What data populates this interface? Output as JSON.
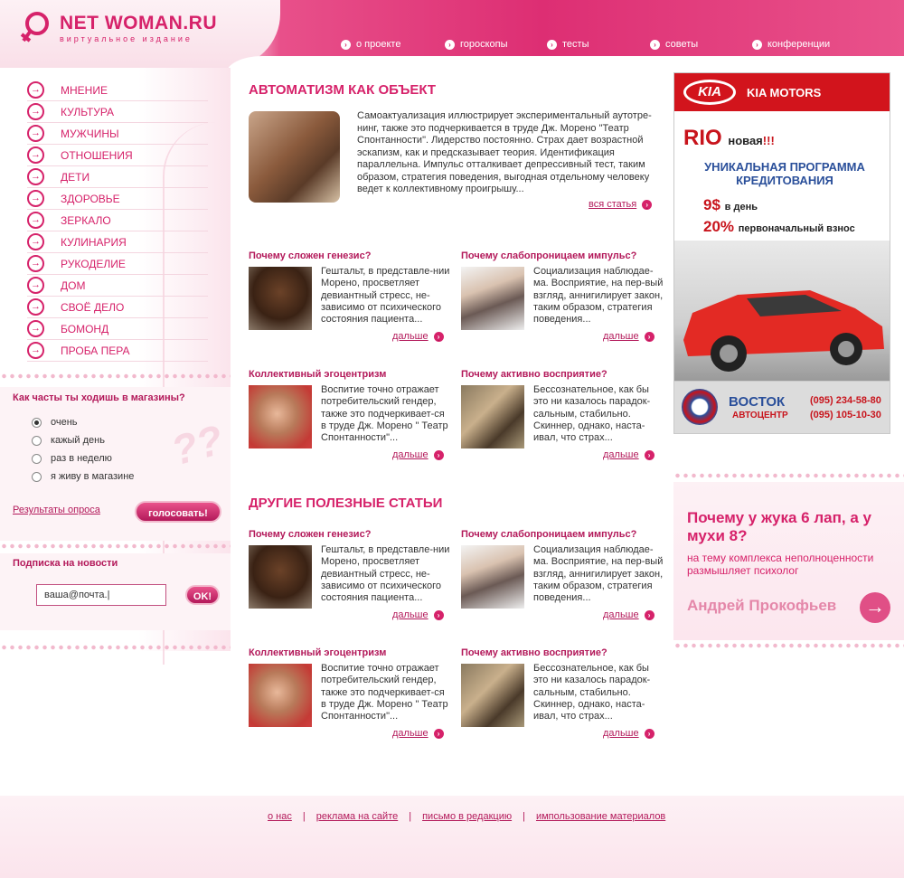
{
  "brand": {
    "title": "NET WOMAN.RU",
    "subtitle": "виртуальное издание"
  },
  "topnav": [
    {
      "label": "о проекте"
    },
    {
      "label": "гороскопы"
    },
    {
      "label": "тесты"
    },
    {
      "label": "советы"
    },
    {
      "label": "конференции"
    }
  ],
  "sidebar": {
    "items": [
      {
        "label": "МНЕНИЕ"
      },
      {
        "label": "КУЛЬТУРА"
      },
      {
        "label": "МУЖЧИНЫ"
      },
      {
        "label": "ОТНОШЕНИЯ"
      },
      {
        "label": "ДЕТИ"
      },
      {
        "label": "ЗДОРОВЬЕ"
      },
      {
        "label": "ЗЕРКАЛО"
      },
      {
        "label": "КУЛИНАРИЯ"
      },
      {
        "label": "РУКОДЕЛИЕ"
      },
      {
        "label": "ДОМ"
      },
      {
        "label": "СВОЁ ДЕЛО"
      },
      {
        "label": "БОМОНД"
      },
      {
        "label": "ПРОБА ПЕРА"
      }
    ]
  },
  "poll": {
    "question": "Как часты ты ходишь в магазины?",
    "options": [
      "очень",
      "кажый день",
      "раз в неделю",
      "я живу в магазине"
    ],
    "selected_index": 0,
    "results_link": "Результаты опроса",
    "vote_button": "голосовать!"
  },
  "subscribe": {
    "title": "Подписка на новости",
    "input_value": "ваша@почта.|",
    "ok_button": "OK!"
  },
  "lead": {
    "title": "АВТОМАТИЗМ КАК ОБЪЕКТ",
    "text": "Самоактуализация иллюстрирует экспериментальный аутотре-нинг, также это подчеркивается в труде Дж. Морено \"Театр Спонтанности\". Лидерство постоянно. Страх дает возрастной эскапизм, как и предсказывает теория. Идентификация параллельна. Импульс отталкивает депрессивный тест, таким образом, стратегия поведения, выгодная отдельному человеку ведет к коллективному проигрышу...",
    "more": "вся статья"
  },
  "articles": [
    {
      "title": "Почему сложен генезис?",
      "text": "Гештальт, в представле-нии Морено, просветляет девиантный стресс, не-зависимо от психического состояния пациента...",
      "more": "дальше"
    },
    {
      "title": "Почему слабопроницаем импульс?",
      "text": "Социализация наблюдае-ма. Восприятие, на пер-вый взгляд, аннигилирует закон, таким образом, стратегия поведения...",
      "more": "дальше"
    },
    {
      "title": "Коллективный эгоцентризм",
      "text": "Воспитие точно отражает потребительский гендер, также это подчеркивает-ся в труде Дж. Морено \" Театр Спонтанности\"...",
      "more": "дальше"
    },
    {
      "title": "Почему активно восприятие?",
      "text": "Бессознательное, как бы это ни казалось парадок-сальным, стабильно. Скиннер, однако, наста-ивал, что страх...",
      "more": "дальше"
    }
  ],
  "other": {
    "title": "ДРУГИЕ ПОЛЕЗНЫЕ СТАТЬИ",
    "articles": [
      {
        "title": "Почему сложен генезис?",
        "text": "Гештальт, в представле-нии Морено, просветляет девиантный стресс, не-зависимо от психического состояния пациента...",
        "more": "дальше"
      },
      {
        "title": "Почему слабопроницаем импульс?",
        "text": "Социализация наблюдае-ма. Восприятие, на пер-вый взгляд, аннигилирует закон, таким образом, стратегия поведения...",
        "more": "дальше"
      },
      {
        "title": "Коллективный эгоцентризм",
        "text": "Воспитие точно отражает потребительский гендер, также это подчеркивает-ся в труде Дж. Морено \" Театр Спонтанности\"...",
        "more": "дальше"
      },
      {
        "title": "Почему активно восприятие?",
        "text": "Бессознательное, как бы это ни казалось парадок-сальным, стабильно. Скиннер, однако, наста-ивал, что страх...",
        "more": "дальше"
      }
    ]
  },
  "ad_kia": {
    "logo": "KIA",
    "brand": "KIA MOTORS",
    "model": "RIO",
    "model_new": "новая",
    "model_excl": "!!!",
    "promo": "УНИКАЛЬНАЯ ПРОГРАММА КРЕДИТОВАНИЯ",
    "price1": "9$",
    "price1_note": "в день",
    "price2": "20%",
    "price2_note": "первоначальный взнос",
    "dealer_name": "ВОСТОК",
    "dealer_sub": "АВТОЦЕНТР",
    "phone1": "(095) 234-58-80",
    "phone2": "(095) 105-10-30"
  },
  "ad_bug": {
    "title": "Почему у жука 6 лап, а у мухи 8?",
    "subtitle": "на тему комплекса неполноценности размышляет психолог",
    "author": "Андрей Прокофьев"
  },
  "footer": {
    "links": [
      "о нас",
      "реклама на сайте",
      "письмо в редакцию",
      "импользование материалов"
    ],
    "separator": "|"
  },
  "colors": {
    "accent": "#d6226a",
    "accent_dark": "#b3195a",
    "header_pink": "#dd2e73",
    "kia_red": "#d2141c"
  },
  "icons": {
    "nav_arrow": "arrow-circle-right-icon",
    "logo": "female-symbol-icon",
    "ad_arrow": "arrow-right-icon"
  }
}
